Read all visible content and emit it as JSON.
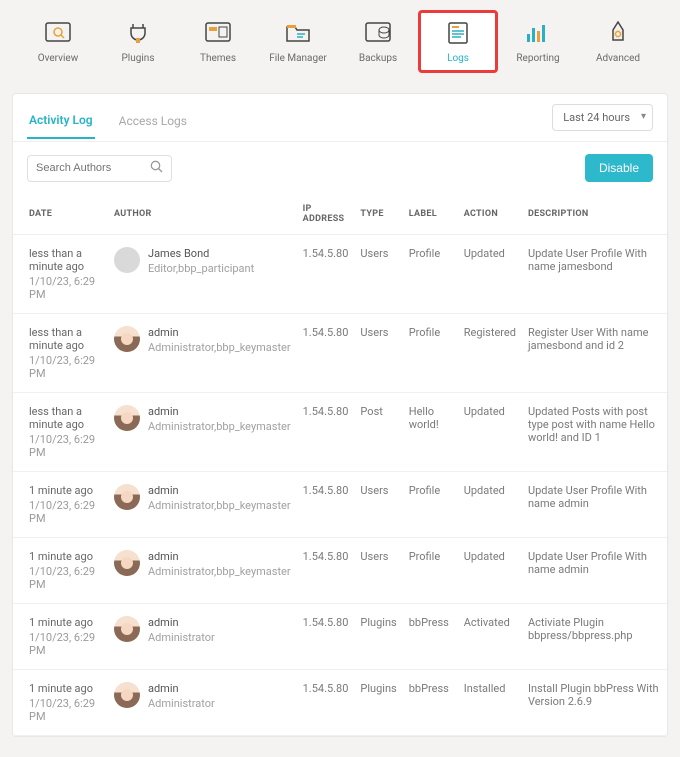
{
  "nav": {
    "items": [
      {
        "label": "Overview"
      },
      {
        "label": "Plugins"
      },
      {
        "label": "Themes"
      },
      {
        "label": "File Manager"
      },
      {
        "label": "Backups"
      },
      {
        "label": "Logs"
      },
      {
        "label": "Reporting"
      },
      {
        "label": "Advanced"
      }
    ],
    "selected": "Logs"
  },
  "tabs": {
    "activity": "Activity Log",
    "access": "Access Logs",
    "active": "activity"
  },
  "range": {
    "label": "Last 24 hours"
  },
  "search": {
    "placeholder": "Search Authors"
  },
  "disable_btn": "Disable",
  "columns": {
    "date": "DATE",
    "author": "AUTHOR",
    "ip": "IP ADDRESS",
    "type": "TYPE",
    "label": "LABEL",
    "action": "ACTION",
    "desc": "DESCRIPTION"
  },
  "rows": [
    {
      "ago": "less than a minute ago",
      "ts": "1/10/23, 6:29 PM",
      "author_name": "James Bond",
      "author_role": "Editor,bbp_participant",
      "avatar": "placeholder",
      "ip": "1.54.5.80",
      "type": "Users",
      "label": "Profile",
      "action": "Updated",
      "desc": "Update User Profile With name jamesbond"
    },
    {
      "ago": "less than a minute ago",
      "ts": "1/10/23, 6:29 PM",
      "author_name": "admin",
      "author_role": "Administrator,bbp_keymaster",
      "avatar": "face",
      "ip": "1.54.5.80",
      "type": "Users",
      "label": "Profile",
      "action": "Registered",
      "desc": "Register User With name jamesbond and id 2"
    },
    {
      "ago": "less than a minute ago",
      "ts": "1/10/23, 6:29 PM",
      "author_name": "admin",
      "author_role": "Administrator,bbp_keymaster",
      "avatar": "face",
      "ip": "1.54.5.80",
      "type": "Post",
      "label": "Hello world!",
      "action": "Updated",
      "desc": "Updated Posts with post type post with name Hello world! and ID 1"
    },
    {
      "ago": "1 minute ago",
      "ts": "1/10/23, 6:29 PM",
      "author_name": "admin",
      "author_role": "Administrator,bbp_keymaster",
      "avatar": "face",
      "ip": "1.54.5.80",
      "type": "Users",
      "label": "Profile",
      "action": "Updated",
      "desc": "Update User Profile With name admin"
    },
    {
      "ago": "1 minute ago",
      "ts": "1/10/23, 6:29 PM",
      "author_name": "admin",
      "author_role": "Administrator,bbp_keymaster",
      "avatar": "face",
      "ip": "1.54.5.80",
      "type": "Users",
      "label": "Profile",
      "action": "Updated",
      "desc": "Update User Profile With name admin"
    },
    {
      "ago": "1 minute ago",
      "ts": "1/10/23, 6:29 PM",
      "author_name": "admin",
      "author_role": "Administrator",
      "avatar": "face",
      "ip": "1.54.5.80",
      "type": "Plugins",
      "label": "bbPress",
      "action": "Activated",
      "desc": "Activiate Plugin bbpress/bbpress.php"
    },
    {
      "ago": "1 minute ago",
      "ts": "1/10/23, 6:29 PM",
      "author_name": "admin",
      "author_role": "Administrator",
      "avatar": "face",
      "ip": "1.54.5.80",
      "type": "Plugins",
      "label": "bbPress",
      "action": "Installed",
      "desc": "Install Plugin bbPress With Version 2.6.9"
    }
  ]
}
